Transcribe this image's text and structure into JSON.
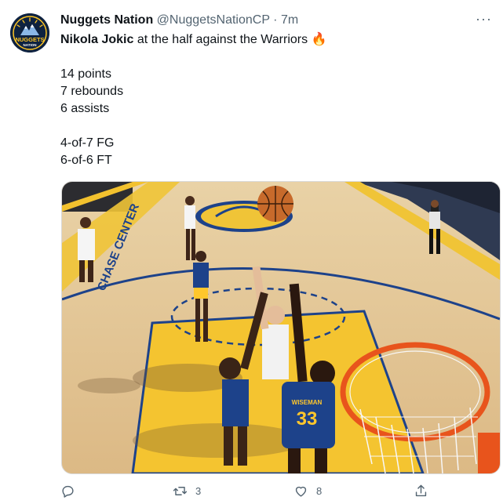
{
  "tweet": {
    "display_name": "Nuggets Nation",
    "handle": "@NuggetsNationCP",
    "separator": "·",
    "time": "7m",
    "more_label": "···",
    "avatar_text": "NUGGETS",
    "avatar_subtext": "NATION",
    "line1_bold": "Nikola Jokic",
    "line1_rest": " at the half against the Warriors",
    "line1_emoji": "🔥",
    "stats": [
      "14 points",
      "7 rebounds",
      "6 assists"
    ],
    "shooting": [
      "4-of-7 FG",
      "6-of-6 FT"
    ],
    "image_text": {
      "baseline_text": "CHASE CENTER",
      "jersey_number": "33",
      "jersey_name": "WISEMAN"
    }
  },
  "actions": {
    "reply_count": "",
    "retweet_count": "3",
    "like_count": "8",
    "share_count": ""
  },
  "colors": {
    "nuggets_navy": "#0e2240",
    "nuggets_gold": "#fec524",
    "warriors_blue": "#1d428a",
    "warriors_gold": "#ffc72c",
    "rim_orange": "#e8541c",
    "icon_gray": "#536471"
  },
  "icons": [
    "avatar-logo-icon",
    "fire-emoji-icon",
    "reply-icon",
    "retweet-icon",
    "like-icon",
    "share-icon",
    "more-icon"
  ]
}
